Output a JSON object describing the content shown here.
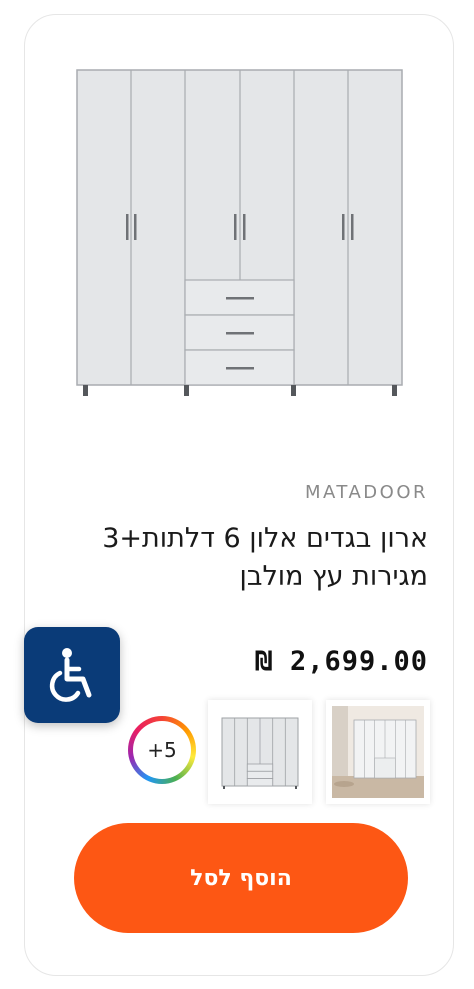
{
  "product": {
    "brand": "MATADOOR",
    "title": "ארון בגדים אלון 6 דלתות+3 מגירות עץ מולבן",
    "price": "2,699.00 ₪"
  },
  "gallery": {
    "more_count": "+5",
    "ring_colors": [
      "#f44336",
      "#ff9800",
      "#ffeb3b",
      "#4caf50",
      "#2196f3",
      "#9c27b0",
      "#e91e63"
    ]
  },
  "actions": {
    "add_to_cart_label": "הוסף לסל"
  },
  "accessibility": {
    "icon": "wheelchair-icon",
    "color": "#0a3b78"
  },
  "colors": {
    "accent": "#fd5714",
    "wardrobe": "#e3e5e7"
  }
}
